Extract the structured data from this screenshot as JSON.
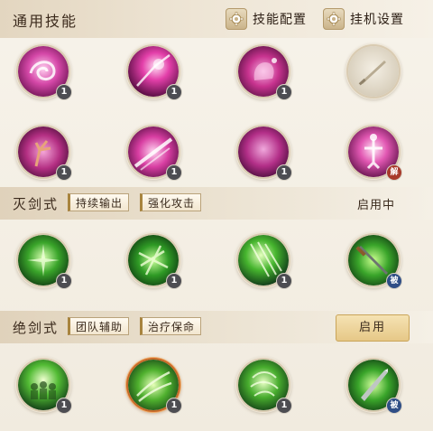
{
  "header": {
    "title": "通用技能",
    "skill_config_label": "技能配置",
    "idle_settings_label": "挂机设置"
  },
  "general_skills": [
    {
      "name": "pink-swirl-skill",
      "badge": "1"
    },
    {
      "name": "pink-burst-skill",
      "badge": "1"
    },
    {
      "name": "pink-palm-skill",
      "badge": "1"
    },
    {
      "name": "locked-sword-skill",
      "badge": ""
    },
    {
      "name": "pink-hand-skill",
      "badge": "1"
    },
    {
      "name": "pink-slash-skill",
      "badge": "1"
    },
    {
      "name": "pink-moon-skill",
      "badge": "1"
    },
    {
      "name": "pink-figure-skill",
      "badge": "解"
    }
  ],
  "sections": [
    {
      "title": "灭剑式",
      "tags": [
        "持续输出",
        "强化攻击"
      ],
      "status": "启用中",
      "skills": [
        {
          "name": "green-burst-skill",
          "badge": "1"
        },
        {
          "name": "green-blades-skill",
          "badge": "1"
        },
        {
          "name": "green-rain-skill",
          "badge": "1"
        },
        {
          "name": "green-sword-skill",
          "badge": "被"
        }
      ]
    },
    {
      "title": "绝剑式",
      "tags": [
        "团队辅助",
        "治疗保命"
      ],
      "button": "启用",
      "skills": [
        {
          "name": "green-team-skill",
          "badge": "1"
        },
        {
          "name": "green-heal-skill",
          "badge": "1"
        },
        {
          "name": "green-guard-skill",
          "badge": "1"
        },
        {
          "name": "green-blade-skill",
          "badge": "被"
        }
      ]
    }
  ],
  "colors": {
    "pink": "#c8338f",
    "green": "#3aa52a",
    "badge_gray": "#4d4d52",
    "badge_red": "#a83a2a",
    "badge_blue": "#2f4e86",
    "gold_button": "#e6c887"
  }
}
